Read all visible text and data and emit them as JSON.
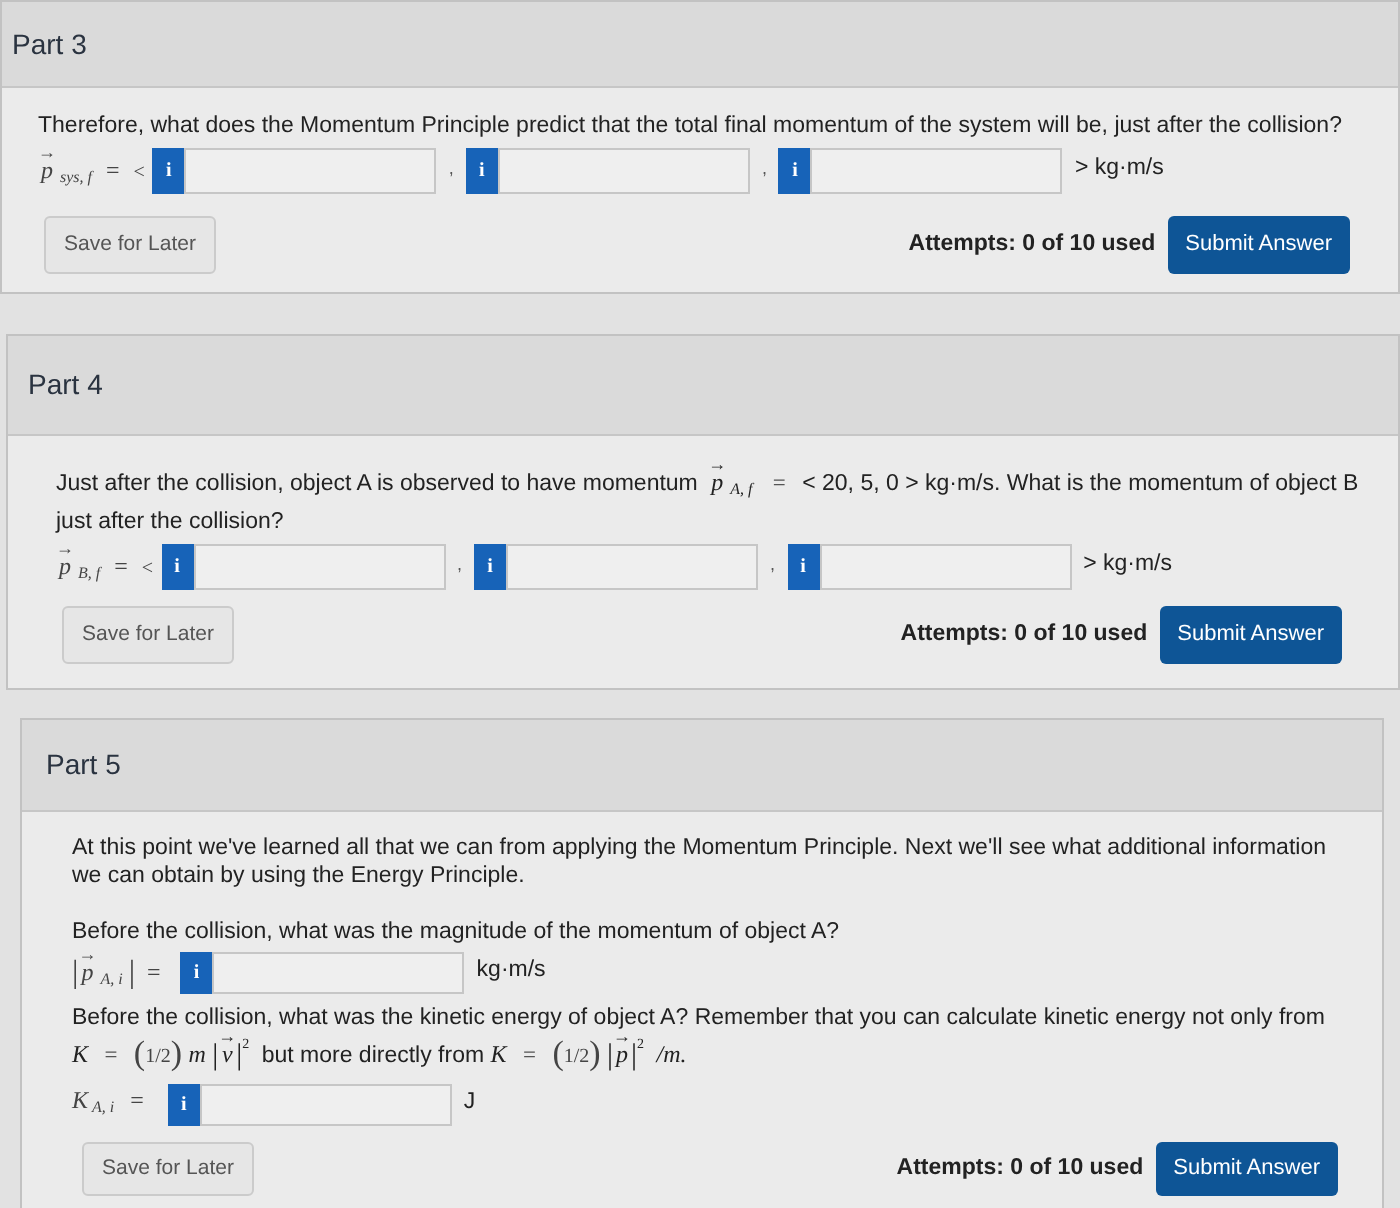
{
  "parts": [
    {
      "title": "Part 3",
      "blocks": [
        {
          "kind": "paragraph",
          "segments": [
            {
              "kind": "text",
              "text": "Therefore, what does the Momentum Principle predict that the total final momentum of the system will be, just after the collision?"
            }
          ]
        },
        {
          "kind": "answer",
          "label": {
            "kind": "vector",
            "arrow": "→",
            "symbol": "p",
            "subscript": "sys, f",
            "equals": "=",
            "open": "<"
          },
          "fields": [
            {
              "info": "i"
            },
            {
              "separator": ",",
              "info": "i"
            },
            {
              "separator": ",",
              "info": "i"
            }
          ],
          "unit": "> kg·m/s"
        }
      ],
      "save": "Save for Later",
      "attempts": "Attempts: 0 of 10 used",
      "submit": "Submit Answer"
    },
    {
      "title": "Part 4",
      "blocks": [
        {
          "kind": "paragraph",
          "segments": [
            {
              "kind": "text",
              "text": "Just after the collision, object A is observed to have momentum"
            },
            {
              "kind": "vector",
              "arrow": "→",
              "symbol": "p",
              "subscript": "A, f"
            },
            {
              "kind": "op",
              "text": "="
            },
            {
              "kind": "text",
              "text": "< 20, 5, 0 > kg·m/s. What is the momentum of object B just after the collision?"
            }
          ]
        },
        {
          "kind": "answer",
          "label": {
            "kind": "vector",
            "arrow": "→",
            "symbol": "p",
            "subscript": "B, f",
            "equals": "=",
            "open": "<"
          },
          "fields": [
            {
              "info": "i"
            },
            {
              "separator": ",",
              "info": "i"
            },
            {
              "separator": ",",
              "info": "i"
            }
          ],
          "unit": "> kg·m/s"
        }
      ],
      "save": "Save for Later",
      "attempts": "Attempts: 0 of 10 used",
      "submit": "Submit Answer"
    },
    {
      "title": "Part 5",
      "blocks": [
        {
          "kind": "paragraph",
          "segments": [
            {
              "kind": "text",
              "text": "At this point we've learned all that we can from applying the Momentum Principle. Next we'll see what additional information we can obtain by using the Energy Principle."
            }
          ]
        },
        {
          "kind": "paragraph",
          "segments": [
            {
              "kind": "text",
              "text": "Before the collision, what was the magnitude of the momentum of object A?"
            }
          ]
        },
        {
          "kind": "answer",
          "label": {
            "kind": "magnitude",
            "left": "|",
            "arrow": "→",
            "symbol": "p",
            "subscript": "A, i",
            "right": "|",
            "equals": "="
          },
          "fields": [
            {
              "info": "i"
            }
          ],
          "unit": "kg·m/s"
        },
        {
          "kind": "paragraph",
          "segments": [
            {
              "kind": "text",
              "text": "Before the collision, what was the kinetic energy of object A? Remember that you can calculate kinetic energy not only from"
            }
          ]
        },
        {
          "kind": "formula",
          "segments": [
            {
              "kind": "math",
              "text": "K"
            },
            {
              "kind": "op",
              "text": "="
            },
            {
              "kind": "paren",
              "open": "(",
              "inner": "1/2",
              "close": ")"
            },
            {
              "kind": "math",
              "text": "m"
            },
            {
              "kind": "abs-vector",
              "left": "|",
              "arrow": "→",
              "symbol": "v",
              "right": "|",
              "power": "2"
            },
            {
              "kind": "text",
              "text": "but more directly from"
            },
            {
              "kind": "math",
              "text": "K"
            },
            {
              "kind": "op",
              "text": "="
            },
            {
              "kind": "paren",
              "open": "(",
              "inner": "1/2",
              "close": ")"
            },
            {
              "kind": "abs-vector",
              "left": "|",
              "arrow": "→",
              "symbol": "p",
              "right": "|",
              "power": "2"
            },
            {
              "kind": "math",
              "text": "/m."
            }
          ]
        },
        {
          "kind": "answer",
          "label": {
            "kind": "scalar",
            "symbol": "K",
            "subscript": "A, i",
            "equals": "="
          },
          "fields": [
            {
              "info": "i"
            }
          ],
          "unit": "J"
        }
      ],
      "save": "Save for Later",
      "attempts": "Attempts: 0 of 10 used",
      "submit": "Submit Answer"
    }
  ]
}
